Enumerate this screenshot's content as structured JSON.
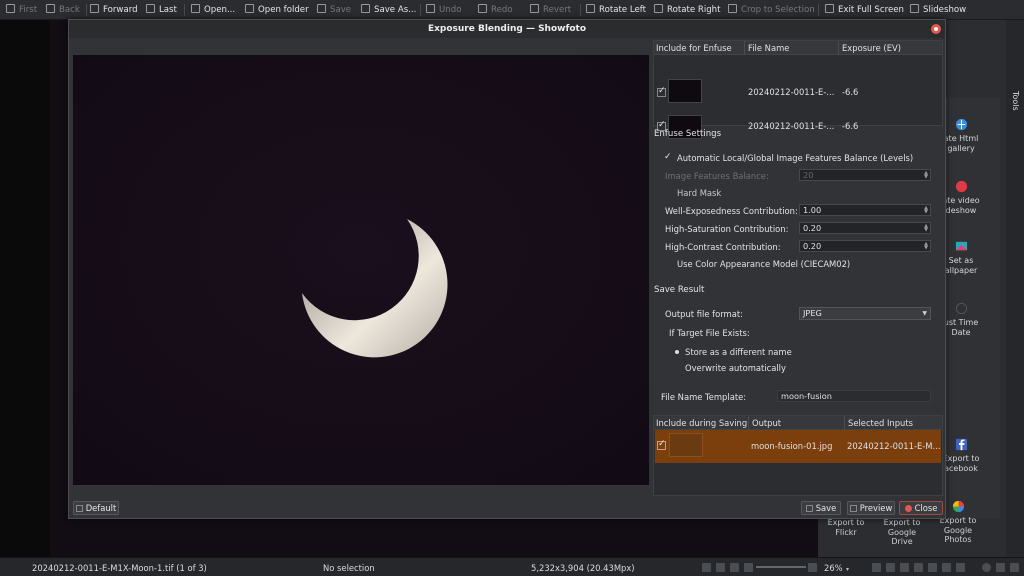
{
  "toolbar": {
    "first": "First",
    "back": "Back",
    "forward": "Forward",
    "last": "Last",
    "open": "Open...",
    "open_folder": "Open folder",
    "save": "Save",
    "save_as": "Save As...",
    "undo": "Undo",
    "redo": "Redo",
    "revert": "Revert",
    "rotate_left": "Rotate Left",
    "rotate_right": "Rotate Right",
    "crop": "Crop to Selection",
    "exit_fullscreen": "Exit Full Screen",
    "slideshow": "Slideshow"
  },
  "tools_panel": {
    "title": "Tools",
    "items": [
      {
        "label": "ate Html",
        "label2": "gallery",
        "icon": "html-gallery-icon"
      },
      {
        "label": "ate video",
        "label2": "deshow",
        "icon": "video-slideshow-icon"
      },
      {
        "label": "Set as",
        "label2": "allpaper",
        "icon": "wallpaper-icon"
      },
      {
        "label": "ust Time",
        "label2": "Date",
        "icon": "clock-icon"
      },
      {
        "label": "Export to",
        "label2": "acebook",
        "icon": "facebook-icon"
      }
    ],
    "bottom_items": [
      {
        "label": "Export to",
        "label2": "Flickr",
        "label3": ""
      },
      {
        "label": "Export to",
        "label2": "Google",
        "label3": "Drive"
      },
      {
        "label": "Export to",
        "label2": "Google",
        "label3": "Photos"
      }
    ]
  },
  "dialog": {
    "title": "Exposure Blending — Showfoto",
    "inputs_table": {
      "headers": [
        "Include for Enfuse",
        "File Name",
        "Exposure (EV)"
      ],
      "rows": [
        {
          "file": "20240212-0011-E-...",
          "ev": "-6.6",
          "checked": true
        },
        {
          "file": "20240212-0011-E-...",
          "ev": "-6.6",
          "checked": true
        }
      ]
    },
    "enfuse_settings": {
      "title": "Enfuse Settings",
      "auto_balance": "Automatic Local/Global Image Features Balance (Levels)",
      "features_balance_label": "Image Features Balance:",
      "features_balance_value": "20",
      "hard_mask": "Hard Mask",
      "well_exposedness_label": "Well-Exposedness Contribution:",
      "well_exposedness_value": "1.00",
      "high_saturation_label": "High-Saturation Contribution:",
      "high_saturation_value": "0.20",
      "high_contrast_label": "High-Contrast Contribution:",
      "high_contrast_value": "0.20",
      "ciecam": "Use Color Appearance Model (CIECAM02)"
    },
    "save_result": {
      "title": "Save Result",
      "format_label": "Output file format:",
      "format_value": "JPEG",
      "target_exists_label": "If Target File Exists:",
      "store_different": "Store as a different name",
      "overwrite": "Overwrite automatically",
      "template_label": "File Name Template:",
      "template_value": "moon-fusion"
    },
    "output_table": {
      "headers": [
        "Include during Saving",
        "Output",
        "Selected Inputs"
      ],
      "rows": [
        {
          "output": "moon-fusion-01.jpg",
          "inputs": "20240212-0011-E-M...",
          "checked": true
        }
      ]
    },
    "buttons": {
      "default": "Default",
      "save": "Save",
      "preview": "Preview",
      "close": "Close"
    }
  },
  "statusbar": {
    "filename": "20240212-0011-E-M1X-Moon-1.tif (1 of 3)",
    "selection": "No selection",
    "dimensions": "5,232x3,904 (20.43Mpx)",
    "zoom": "26%"
  },
  "colors": {
    "accent_row": "#7a3f0c",
    "close_red": "#e0584f",
    "sky": "#120c15"
  }
}
